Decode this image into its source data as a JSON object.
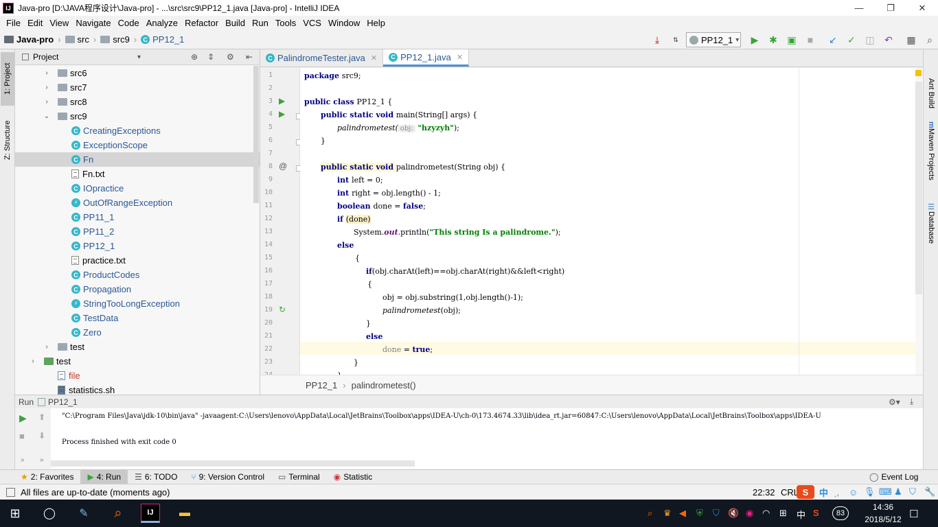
{
  "window": {
    "title": "Java-pro [D:\\JAVA程序设计\\Java-pro] - ...\\src\\src9\\PP12_1.java [Java-pro] - IntelliJ IDEA",
    "app_icon": "IJ",
    "controls": {
      "minimize": "—",
      "restore": "❐",
      "close": "✕"
    }
  },
  "menu": [
    "File",
    "Edit",
    "View",
    "Navigate",
    "Code",
    "Analyze",
    "Refactor",
    "Build",
    "Run",
    "Tools",
    "VCS",
    "Window",
    "Help"
  ],
  "navbar": {
    "crumbs": [
      "Java-pro",
      "src",
      "src9",
      "PP12_1"
    ],
    "run_config": "PP12_1"
  },
  "left_stripe": {
    "project_tab": "1: Project",
    "structure_tab": "Z: Structure"
  },
  "project_panel": {
    "title": "Project",
    "tree": [
      {
        "label": "src6",
        "kind": "folder",
        "arrow": "›"
      },
      {
        "label": "src7",
        "kind": "folder",
        "arrow": "›"
      },
      {
        "label": "src8",
        "kind": "folder",
        "arrow": "›"
      },
      {
        "label": "src9",
        "kind": "folder",
        "arrow": "⌄"
      },
      {
        "label": "CreatingExceptions",
        "kind": "class"
      },
      {
        "label": "ExceptionScope",
        "kind": "class"
      },
      {
        "label": "Fn",
        "kind": "class",
        "selected": true
      },
      {
        "label": "Fn.txt",
        "kind": "text"
      },
      {
        "label": "IOpractice",
        "kind": "class"
      },
      {
        "label": "OutOfRangeException",
        "kind": "exception"
      },
      {
        "label": "PP11_1",
        "kind": "class"
      },
      {
        "label": "PP11_2",
        "kind": "class"
      },
      {
        "label": "PP12_1",
        "kind": "class"
      },
      {
        "label": "practice.txt",
        "kind": "text"
      },
      {
        "label": "ProductCodes",
        "kind": "class"
      },
      {
        "label": "Propagation",
        "kind": "class"
      },
      {
        "label": "StringTooLongException",
        "kind": "exception"
      },
      {
        "label": "TestData",
        "kind": "class"
      },
      {
        "label": "Zero",
        "kind": "class"
      },
      {
        "label": "test",
        "kind": "folder",
        "arrow": "›"
      },
      {
        "label": "test",
        "kind": "folder-green",
        "arrow": "›"
      },
      {
        "label": "file",
        "kind": "file"
      },
      {
        "label": "statistics.sh",
        "kind": "script"
      }
    ]
  },
  "editor": {
    "tabs": [
      {
        "label": "PalindromeTester.java",
        "active": false
      },
      {
        "label": "PP12_1.java",
        "active": true
      }
    ],
    "line_numbers": [
      "1",
      "2",
      "3",
      "4",
      "5",
      "6",
      "7",
      "8",
      "9",
      "10",
      "11",
      "12",
      "13",
      "14",
      "15",
      "16",
      "17",
      "18",
      "19",
      "20",
      "21",
      "22",
      "23",
      "24"
    ],
    "code": {
      "l1": "package src9;",
      "l3a": "public class ",
      "l3b": "PP12_1 {",
      "l4a": "public static void ",
      "l4b": "main(String[] args) {",
      "l5a": "palindrometest(",
      "l5hint": "obj:",
      "l5str": "\"hzyzyh\"",
      "l5c": ");",
      "l6": "}",
      "l8a": "public static void ",
      "l8b": "palindrometest(String obj) {",
      "l9a": "int ",
      "l9b": "left = 0;",
      "l10a": "int ",
      "l10b": "right = obj.length() - 1;",
      "l11a": "boolean ",
      "l11b": "done = ",
      "l11c": "false",
      "l11d": ";",
      "l12a": "if ",
      "l12b": "(done)",
      "l13a": "System.",
      "l13b": "out",
      "l13c": ".println(",
      "l13d": "\"This string Is a palindrome.\"",
      "l13e": ");",
      "l14": "else",
      "l15": "{",
      "l16a": "if",
      "l16b": "(obj.charAt(left)==obj.charAt(right)&&left<right)",
      "l17": "{",
      "l18": "obj = obj.substring(1,obj.length()-1);",
      "l19a": "palindrometest",
      "l19b": "(obj);",
      "l20": "}",
      "l21": "else",
      "l22a": "done",
      "l22b": " = ",
      "l22c": "true",
      "l22d": ";",
      "l23": "}",
      "l24": "}"
    },
    "breadcrumb": [
      "PP12_1",
      "palindrometest()"
    ]
  },
  "right_stripe": [
    "Ant Build",
    "Maven Projects",
    "Database"
  ],
  "run_panel": {
    "label": "Run",
    "config": "PP12_1",
    "command": "\"C:\\Program Files\\Java\\jdk-10\\bin\\java\" -javaagent:C:\\Users\\lenovo\\AppData\\Local\\JetBrains\\Toolbox\\apps\\IDEA-U\\ch-0\\173.4674.33\\lib\\idea_rt.jar=60847:C:\\Users\\lenovo\\AppData\\Local\\JetBrains\\Toolbox\\apps\\IDEA-U",
    "exit": "Process finished with exit code 0"
  },
  "bottom_tabs": [
    {
      "label": "2: Favorites",
      "icon": "★"
    },
    {
      "label": "4: Run",
      "icon": "▶",
      "active": true
    },
    {
      "label": "6: TODO",
      "icon": "☰"
    },
    {
      "label": "9: Version Control",
      "icon": "⑂"
    },
    {
      "label": "Terminal",
      "icon": "▭"
    },
    {
      "label": "Statistic",
      "icon": "◉"
    }
  ],
  "event_log": "Event Log",
  "status": {
    "message": "All files are up-to-date (moments ago)",
    "position": "22:32",
    "line_sep": "CRLF",
    "ime_char": "中"
  },
  "taskbar": {
    "clock_time": "14:36",
    "clock_date": "2018/5/12",
    "lang": "中",
    "badge": "83"
  },
  "colors": {
    "keyword": "#000080",
    "string": "#008000",
    "accent": "#4a8fd6",
    "class_icon": "#34b7c8"
  }
}
